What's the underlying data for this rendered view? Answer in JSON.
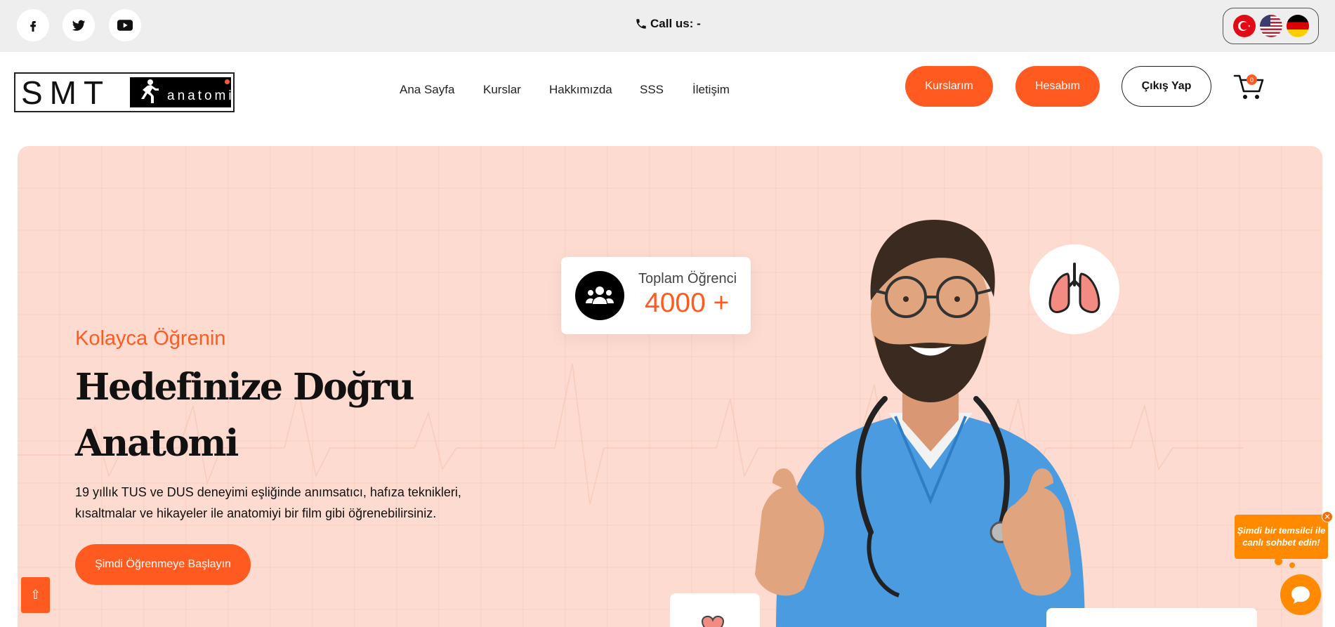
{
  "topbar": {
    "call_label": "Call us: -",
    "social": [
      "facebook-icon",
      "twitter-icon",
      "youtube-icon"
    ],
    "languages": [
      "Türkçe",
      "English",
      "Deutsch"
    ]
  },
  "header": {
    "logo_left": "SMT",
    "logo_right": "anatomi",
    "nav": [
      "Ana Sayfa",
      "Kurslar",
      "Hakkımızda",
      "SSS",
      "İletişim"
    ],
    "btn_courses": "Kurslarım",
    "btn_account": "Hesabım",
    "btn_logout": "Çıkış Yap",
    "cart_count": "0"
  },
  "hero": {
    "kicker": "Kolayca Öğrenin",
    "headline_line1": "Hedefinize Doğru",
    "headline_line2": "Anatomi",
    "desc_line1": "19 yıllık TUS ve DUS deneyimi eşliğinde anımsatıcı, hafıza teknikleri,",
    "desc_line2": "kısaltmalar ve hikayeler ile anatomiyi bir film gibi öğrenebilirsiniz.",
    "cta": "Şimdi Öğrenmeye Başlayın",
    "stat_label": "Toplam Öğrenci",
    "stat_value": "4000 +"
  },
  "chat": {
    "bubble": "Şimdi bir temsilci ile canlı sohbet edin!",
    "close": "✕"
  },
  "scroll_top": "⇧",
  "colors": {
    "accent": "#ff5a1f",
    "hero_bg": "#fddbd0",
    "chat": "#ff8a00"
  }
}
